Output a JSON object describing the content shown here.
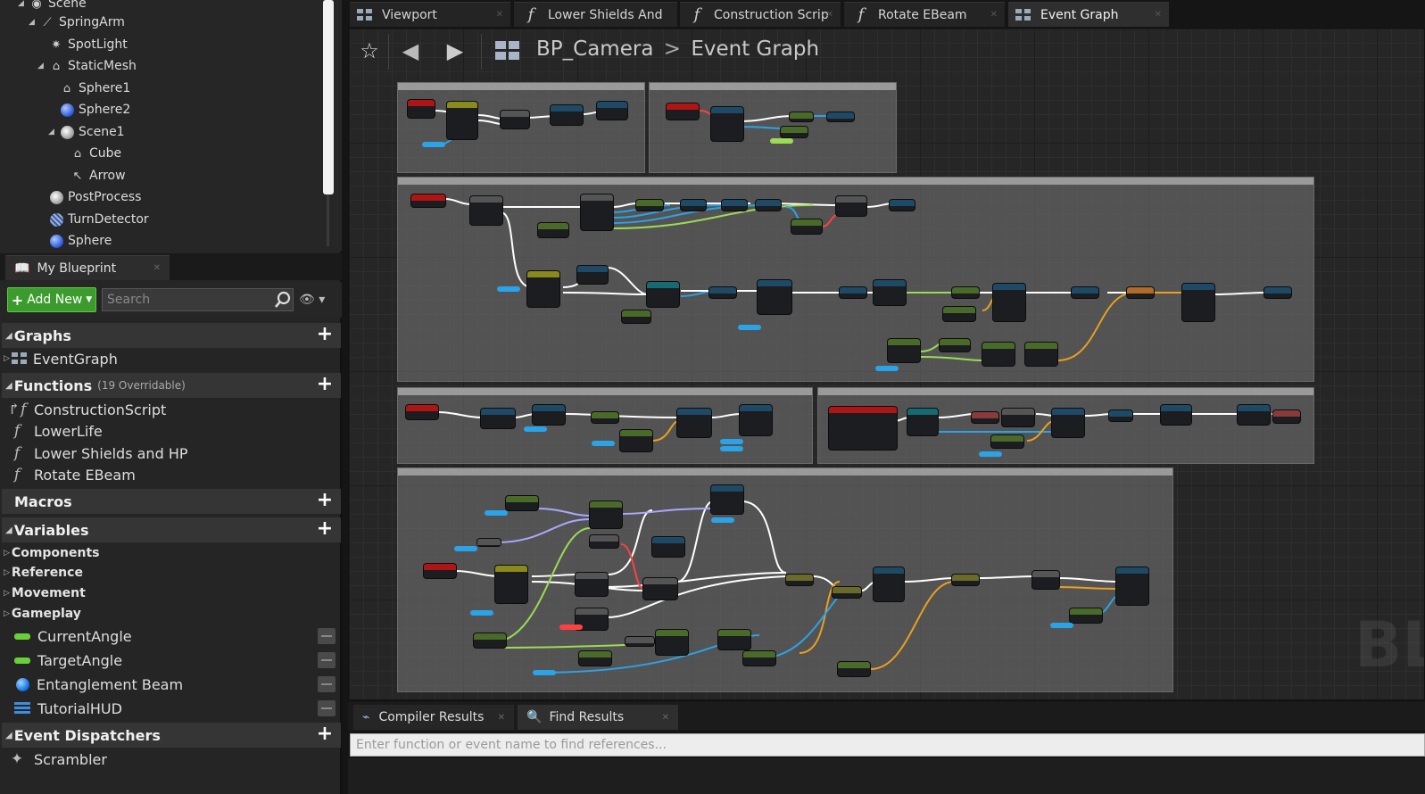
{
  "components": {
    "items": [
      {
        "label": "Scene",
        "icon": "scene-icon"
      },
      {
        "label": "SpringArm",
        "icon": "springarm-icon"
      },
      {
        "label": "SpotLight",
        "icon": "spotlight-icon"
      },
      {
        "label": "StaticMesh",
        "icon": "staticmesh-icon"
      },
      {
        "label": "Sphere1",
        "icon": "mesh-icon"
      },
      {
        "label": "Sphere2",
        "icon": "sphere-icon"
      },
      {
        "label": "Scene1",
        "icon": "scene-icon"
      },
      {
        "label": "Cube",
        "icon": "mesh-icon"
      },
      {
        "label": "Arrow",
        "icon": "arrow-icon"
      },
      {
        "label": "PostProcess",
        "icon": "postprocess-icon"
      },
      {
        "label": "TurnDetector",
        "icon": "turndetector-icon"
      },
      {
        "label": "Sphere",
        "icon": "sphere-icon"
      }
    ]
  },
  "my_blueprint": {
    "tab_label": "My Blueprint",
    "add_new_label": "Add New",
    "search_placeholder": "Search",
    "graphs": {
      "title": "Graphs",
      "items": [
        "EventGraph"
      ]
    },
    "functions": {
      "title": "Functions",
      "subtitle": "(19 Overridable)",
      "items": [
        "ConstructionScript",
        "LowerLife",
        "Lower Shields and HP",
        "Rotate EBeam"
      ]
    },
    "macros": {
      "title": "Macros"
    },
    "variables": {
      "title": "Variables",
      "categories": [
        "Components",
        "Reference",
        "Movement",
        "Gameplay"
      ],
      "items": [
        {
          "label": "CurrentAngle",
          "type": "float",
          "color": "#6ad03a"
        },
        {
          "label": "TargetAngle",
          "type": "float",
          "color": "#6ad03a"
        },
        {
          "label": "Entanglement Beam",
          "type": "object",
          "color": "#0c6be0"
        },
        {
          "label": "TutorialHUD",
          "type": "widget",
          "color": "#3e8de0"
        }
      ]
    },
    "event_dispatchers": {
      "title": "Event Dispatchers",
      "items": [
        "Scrambler"
      ]
    }
  },
  "editor_tabs": [
    {
      "label": "Viewport",
      "icon": "viewport-icon"
    },
    {
      "label": "Lower Shields And",
      "icon": "function-icon"
    },
    {
      "label": "Construction Scrip",
      "icon": "function-icon"
    },
    {
      "label": "Rotate EBeam",
      "icon": "function-icon"
    },
    {
      "label": "Event Graph",
      "icon": "eventgraph-icon",
      "active": true
    }
  ],
  "graph": {
    "breadcrumb_root": "BP_Camera",
    "breadcrumb_separator": ">",
    "breadcrumb_current": "Event Graph",
    "watermark": "BL"
  },
  "bottom": {
    "tabs": [
      {
        "label": "Compiler Results",
        "icon": "compiler-icon"
      },
      {
        "label": "Find Results",
        "icon": "find-icon",
        "active": true
      }
    ],
    "find_placeholder": "Enter function or event name to find references..."
  },
  "colors": {
    "add_new": "#3c9b2d",
    "float_var": "#6ad03a",
    "object_var": "#0c6be0",
    "exec_wire": "#ffffff",
    "object_wire": "#2aa3e8",
    "float_wire": "#9bdc54",
    "struct_wire": "#e8a020",
    "event_node": "#b01515"
  }
}
